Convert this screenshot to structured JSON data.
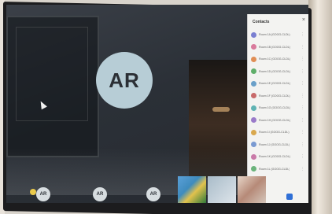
{
  "main_avatar": {
    "initials": "AR"
  },
  "contacts_panel": {
    "title": "Contacts",
    "close_glyph": "×",
    "items": [
      {
        "name": "Room 1A (GOOG-CLDL)",
        "color": "#7a7fd1"
      },
      {
        "name": "Room 1B (GOOG-CLDL)",
        "color": "#d97a9c"
      },
      {
        "name": "Room 1C (GOOG-CLDL)",
        "color": "#e08e55"
      },
      {
        "name": "Room 1D (GOOG-CLDL)",
        "color": "#5fae6a"
      },
      {
        "name": "Room 1E (GOOG-CLDL)",
        "color": "#6aa0c9"
      },
      {
        "name": "Room 1F (GOOG-CLDL)",
        "color": "#c86a6a"
      },
      {
        "name": "Room 1G (GOOG-CLDL)",
        "color": "#5fb3b3"
      },
      {
        "name": "Room 1H (GOOG-CLDL)",
        "color": "#9a7ac9"
      },
      {
        "name": "Room 1I (GOOG-CLDL)",
        "color": "#d9a84e"
      },
      {
        "name": "Room 1J (GOOG-CLDL)",
        "color": "#7a9ad1"
      },
      {
        "name": "Room 1K (GOOG-CLDL)",
        "color": "#c97aa8"
      },
      {
        "name": "Room 1L (GOOG-CLDL)",
        "color": "#6ab37a"
      }
    ]
  },
  "participants": [
    {
      "initials": "AR"
    },
    {
      "initials": "AR"
    },
    {
      "initials": "AR"
    }
  ]
}
